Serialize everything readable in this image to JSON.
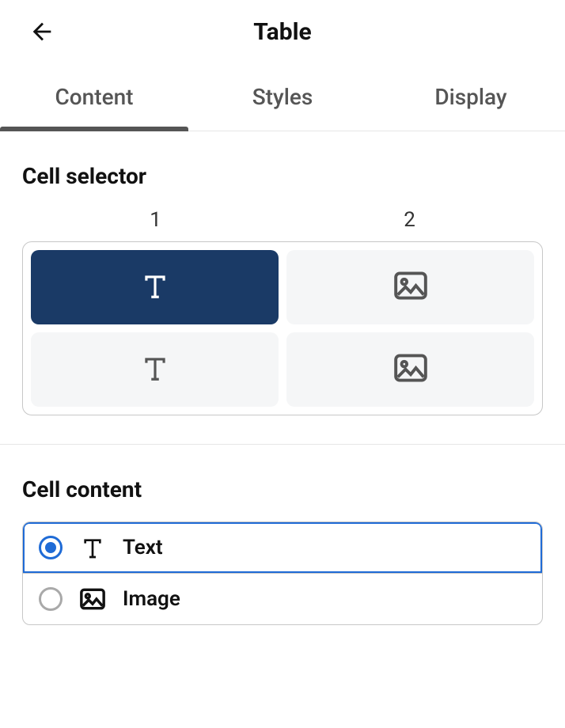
{
  "header": {
    "title": "Table"
  },
  "tabs": [
    {
      "label": "Content",
      "active": true
    },
    {
      "label": "Styles",
      "active": false
    },
    {
      "label": "Display",
      "active": false
    }
  ],
  "cell_selector": {
    "title": "Cell selector",
    "columns": [
      "1",
      "2"
    ],
    "cells": [
      {
        "row": 0,
        "col": 0,
        "type": "text",
        "selected": true
      },
      {
        "row": 0,
        "col": 1,
        "type": "image",
        "selected": false
      },
      {
        "row": 1,
        "col": 0,
        "type": "text",
        "selected": false
      },
      {
        "row": 1,
        "col": 1,
        "type": "image",
        "selected": false
      }
    ]
  },
  "cell_content": {
    "title": "Cell content",
    "options": [
      {
        "value": "text",
        "label": "Text",
        "selected": true
      },
      {
        "value": "image",
        "label": "Image",
        "selected": false
      }
    ]
  }
}
